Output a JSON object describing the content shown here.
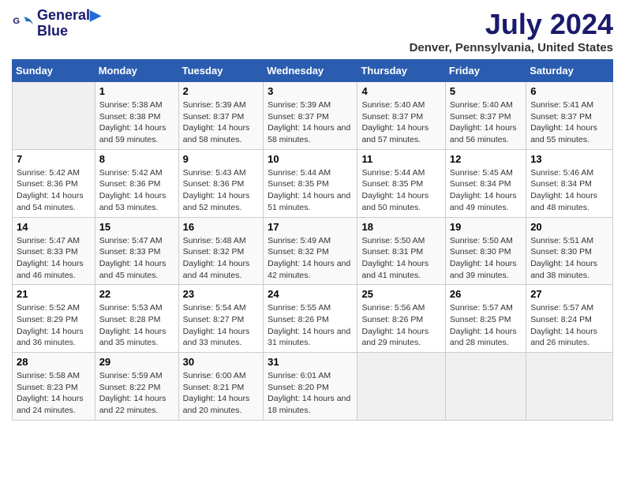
{
  "logo": {
    "line1": "General",
    "line2": "Blue"
  },
  "title": "July 2024",
  "location": "Denver, Pennsylvania, United States",
  "days_of_week": [
    "Sunday",
    "Monday",
    "Tuesday",
    "Wednesday",
    "Thursday",
    "Friday",
    "Saturday"
  ],
  "weeks": [
    [
      {
        "day": "",
        "empty": true
      },
      {
        "day": "1",
        "sunrise": "5:38 AM",
        "sunset": "8:38 PM",
        "daylight": "14 hours and 59 minutes."
      },
      {
        "day": "2",
        "sunrise": "5:39 AM",
        "sunset": "8:37 PM",
        "daylight": "14 hours and 58 minutes."
      },
      {
        "day": "3",
        "sunrise": "5:39 AM",
        "sunset": "8:37 PM",
        "daylight": "14 hours and 58 minutes."
      },
      {
        "day": "4",
        "sunrise": "5:40 AM",
        "sunset": "8:37 PM",
        "daylight": "14 hours and 57 minutes."
      },
      {
        "day": "5",
        "sunrise": "5:40 AM",
        "sunset": "8:37 PM",
        "daylight": "14 hours and 56 minutes."
      },
      {
        "day": "6",
        "sunrise": "5:41 AM",
        "sunset": "8:37 PM",
        "daylight": "14 hours and 55 minutes."
      }
    ],
    [
      {
        "day": "7",
        "sunrise": "5:42 AM",
        "sunset": "8:36 PM",
        "daylight": "14 hours and 54 minutes."
      },
      {
        "day": "8",
        "sunrise": "5:42 AM",
        "sunset": "8:36 PM",
        "daylight": "14 hours and 53 minutes."
      },
      {
        "day": "9",
        "sunrise": "5:43 AM",
        "sunset": "8:36 PM",
        "daylight": "14 hours and 52 minutes."
      },
      {
        "day": "10",
        "sunrise": "5:44 AM",
        "sunset": "8:35 PM",
        "daylight": "14 hours and 51 minutes."
      },
      {
        "day": "11",
        "sunrise": "5:44 AM",
        "sunset": "8:35 PM",
        "daylight": "14 hours and 50 minutes."
      },
      {
        "day": "12",
        "sunrise": "5:45 AM",
        "sunset": "8:34 PM",
        "daylight": "14 hours and 49 minutes."
      },
      {
        "day": "13",
        "sunrise": "5:46 AM",
        "sunset": "8:34 PM",
        "daylight": "14 hours and 48 minutes."
      }
    ],
    [
      {
        "day": "14",
        "sunrise": "5:47 AM",
        "sunset": "8:33 PM",
        "daylight": "14 hours and 46 minutes."
      },
      {
        "day": "15",
        "sunrise": "5:47 AM",
        "sunset": "8:33 PM",
        "daylight": "14 hours and 45 minutes."
      },
      {
        "day": "16",
        "sunrise": "5:48 AM",
        "sunset": "8:32 PM",
        "daylight": "14 hours and 44 minutes."
      },
      {
        "day": "17",
        "sunrise": "5:49 AM",
        "sunset": "8:32 PM",
        "daylight": "14 hours and 42 minutes."
      },
      {
        "day": "18",
        "sunrise": "5:50 AM",
        "sunset": "8:31 PM",
        "daylight": "14 hours and 41 minutes."
      },
      {
        "day": "19",
        "sunrise": "5:50 AM",
        "sunset": "8:30 PM",
        "daylight": "14 hours and 39 minutes."
      },
      {
        "day": "20",
        "sunrise": "5:51 AM",
        "sunset": "8:30 PM",
        "daylight": "14 hours and 38 minutes."
      }
    ],
    [
      {
        "day": "21",
        "sunrise": "5:52 AM",
        "sunset": "8:29 PM",
        "daylight": "14 hours and 36 minutes."
      },
      {
        "day": "22",
        "sunrise": "5:53 AM",
        "sunset": "8:28 PM",
        "daylight": "14 hours and 35 minutes."
      },
      {
        "day": "23",
        "sunrise": "5:54 AM",
        "sunset": "8:27 PM",
        "daylight": "14 hours and 33 minutes."
      },
      {
        "day": "24",
        "sunrise": "5:55 AM",
        "sunset": "8:26 PM",
        "daylight": "14 hours and 31 minutes."
      },
      {
        "day": "25",
        "sunrise": "5:56 AM",
        "sunset": "8:26 PM",
        "daylight": "14 hours and 29 minutes."
      },
      {
        "day": "26",
        "sunrise": "5:57 AM",
        "sunset": "8:25 PM",
        "daylight": "14 hours and 28 minutes."
      },
      {
        "day": "27",
        "sunrise": "5:57 AM",
        "sunset": "8:24 PM",
        "daylight": "14 hours and 26 minutes."
      }
    ],
    [
      {
        "day": "28",
        "sunrise": "5:58 AM",
        "sunset": "8:23 PM",
        "daylight": "14 hours and 24 minutes."
      },
      {
        "day": "29",
        "sunrise": "5:59 AM",
        "sunset": "8:22 PM",
        "daylight": "14 hours and 22 minutes."
      },
      {
        "day": "30",
        "sunrise": "6:00 AM",
        "sunset": "8:21 PM",
        "daylight": "14 hours and 20 minutes."
      },
      {
        "day": "31",
        "sunrise": "6:01 AM",
        "sunset": "8:20 PM",
        "daylight": "14 hours and 18 minutes."
      },
      {
        "day": "",
        "empty": true
      },
      {
        "day": "",
        "empty": true
      },
      {
        "day": "",
        "empty": true
      }
    ]
  ],
  "labels": {
    "sunrise": "Sunrise:",
    "sunset": "Sunset:",
    "daylight": "Daylight:"
  }
}
